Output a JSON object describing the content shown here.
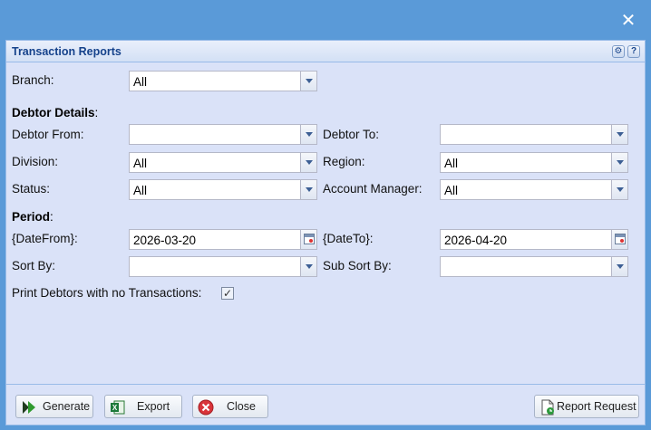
{
  "window": {
    "close_glyph": "✕"
  },
  "panel": {
    "title": "Transaction Reports",
    "tools": {
      "settings_glyph": "⚙",
      "help_glyph": "?"
    }
  },
  "form": {
    "branch": {
      "label": "Branch:",
      "value": "All"
    },
    "debtor_section": "Debtor Details",
    "debtor_from": {
      "label": "Debtor From:",
      "value": ""
    },
    "debtor_to": {
      "label": "Debtor To:",
      "value": ""
    },
    "division": {
      "label": "Division:",
      "value": "All"
    },
    "region": {
      "label": "Region:",
      "value": "All"
    },
    "status": {
      "label": "Status:",
      "value": "All"
    },
    "account_manager": {
      "label": "Account Manager:",
      "value": "All"
    },
    "period_section": "Period",
    "date_from": {
      "label": "{DateFrom}:",
      "value": "2026-03-20"
    },
    "date_to": {
      "label": "{DateTo}:",
      "value": "2026-04-20"
    },
    "sort_by": {
      "label": "Sort By:",
      "value": ""
    },
    "sub_sort_by": {
      "label": "Sub Sort By:",
      "value": ""
    },
    "print_no_tx": {
      "label": "Print Debtors with no Transactions:",
      "checked": true,
      "glyph": "✓"
    }
  },
  "toolbar": {
    "generate": "Generate",
    "export": "Export",
    "close": "Close",
    "report_request": "Report Request"
  },
  "colors": {
    "window_bg": "#5a9ad8",
    "panel_bg": "#dae2f8",
    "title_text": "#15428b"
  }
}
